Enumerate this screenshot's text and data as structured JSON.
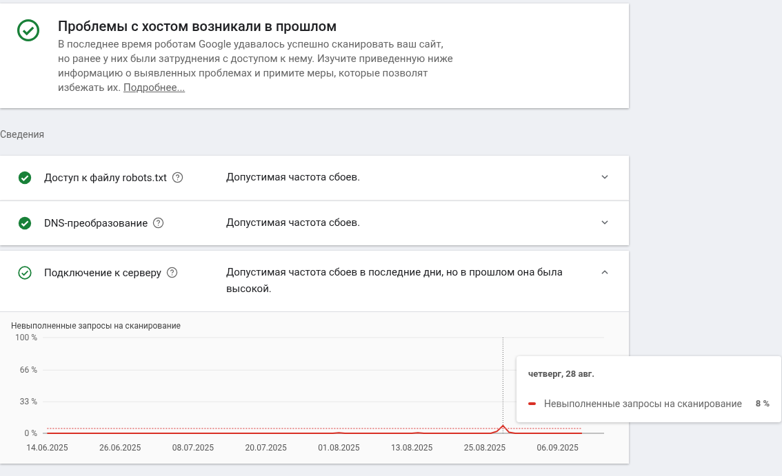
{
  "banner": {
    "title": "Проблемы с хостом возникали в прошлом",
    "text": "В последнее время роботам Google удавалось успешно сканировать ваш сайт, но ранее у них были затруднения с доступом к нему. Изучите приведенную ниже информацию о выявленных проблемах и примите меры, которые позволят избежать их.",
    "link": "Подробнее..."
  },
  "section_label": "Сведения",
  "checks": [
    {
      "kind": "filled",
      "name": "Доступ к файлу robots.txt",
      "status": "Допустимая частота сбоев.",
      "expanded": false
    },
    {
      "kind": "filled",
      "name": "DNS-преобразование",
      "status": "Допустимая частота сбоев.",
      "expanded": false
    },
    {
      "kind": "outline",
      "name": "Подключение к серверу",
      "status": "Допустимая частота сбоев в последние дни, но в прошлом она была высокой.",
      "expanded": true,
      "chart_data": {
        "type": "line",
        "title": "Невыполненные запросы на сканирование",
        "categories": [
          "14.06.2025",
          null,
          null,
          null,
          null,
          null,
          null,
          null,
          null,
          null,
          null,
          null,
          "26.06.2025",
          null,
          null,
          null,
          null,
          null,
          null,
          null,
          null,
          null,
          null,
          null,
          "08.07.2025",
          null,
          null,
          null,
          null,
          null,
          null,
          null,
          null,
          null,
          null,
          null,
          "20.07.2025",
          null,
          null,
          null,
          null,
          null,
          null,
          null,
          null,
          null,
          null,
          null,
          "01.08.2025",
          null,
          null,
          null,
          null,
          null,
          null,
          null,
          null,
          null,
          null,
          null,
          "13.08.2025",
          null,
          null,
          null,
          null,
          null,
          null,
          null,
          null,
          null,
          null,
          null,
          "25.08.2025",
          null,
          null,
          null,
          null,
          null,
          null,
          null,
          null,
          null,
          null,
          null,
          "06.09.2025",
          null,
          null,
          null,
          null
        ],
        "series": [
          {
            "name": "Невыполненные запросы на сканирование",
            "color": "#d93025",
            "values": [
              0,
              0,
              0,
              0,
              0,
              0,
              0,
              0,
              0,
              0,
              0,
              0,
              0,
              0,
              0,
              0,
              0,
              0,
              0,
              0,
              0,
              0,
              0,
              0,
              0,
              0,
              0,
              0,
              0,
              0,
              0,
              0,
              0,
              0,
              0,
              0,
              0,
              0,
              0,
              0,
              0,
              0,
              0,
              0,
              0,
              0,
              0,
              0,
              0.5,
              0,
              0,
              0,
              0,
              0,
              0,
              0,
              0,
              0,
              0,
              0,
              0,
              0.5,
              0,
              0,
              0,
              0,
              0,
              0,
              0,
              0,
              0,
              0,
              0,
              0,
              2,
              8,
              1,
              0,
              0,
              0,
              0,
              0,
              0,
              0,
              0,
              0,
              0,
              0,
              0
            ]
          },
          {
            "color": "#e57373",
            "line_style": "dotted",
            "values": [
              5,
              5,
              5,
              5,
              5,
              5,
              5,
              5,
              5,
              5,
              5,
              5,
              5,
              5,
              5,
              5,
              5,
              5,
              5,
              5,
              5,
              5,
              5,
              5,
              5,
              5,
              5,
              5,
              5,
              5,
              5,
              5,
              5,
              5,
              5,
              5,
              5,
              5,
              5,
              5,
              5,
              5,
              5,
              5,
              5,
              5,
              5,
              5,
              5,
              5,
              5,
              5,
              5,
              5,
              5,
              5,
              5,
              5,
              5,
              5,
              5,
              5,
              5,
              5,
              5,
              5,
              5,
              5,
              5,
              5,
              5,
              5,
              5,
              5,
              5,
              5,
              5,
              5,
              5,
              5,
              5,
              5,
              5,
              5,
              5,
              5,
              5,
              5,
              5
            ]
          }
        ],
        "ylim": [
          0,
          100
        ],
        "yticks": [
          {
            "value": 0,
            "label": "0 %"
          },
          {
            "value": 33,
            "label": "33 %"
          },
          {
            "value": 66,
            "label": "66 %"
          },
          {
            "value": 100,
            "label": "100 %"
          }
        ]
      },
      "tooltip": {
        "date": "четверг, 28 авг.",
        "value": "8 %"
      }
    }
  ]
}
